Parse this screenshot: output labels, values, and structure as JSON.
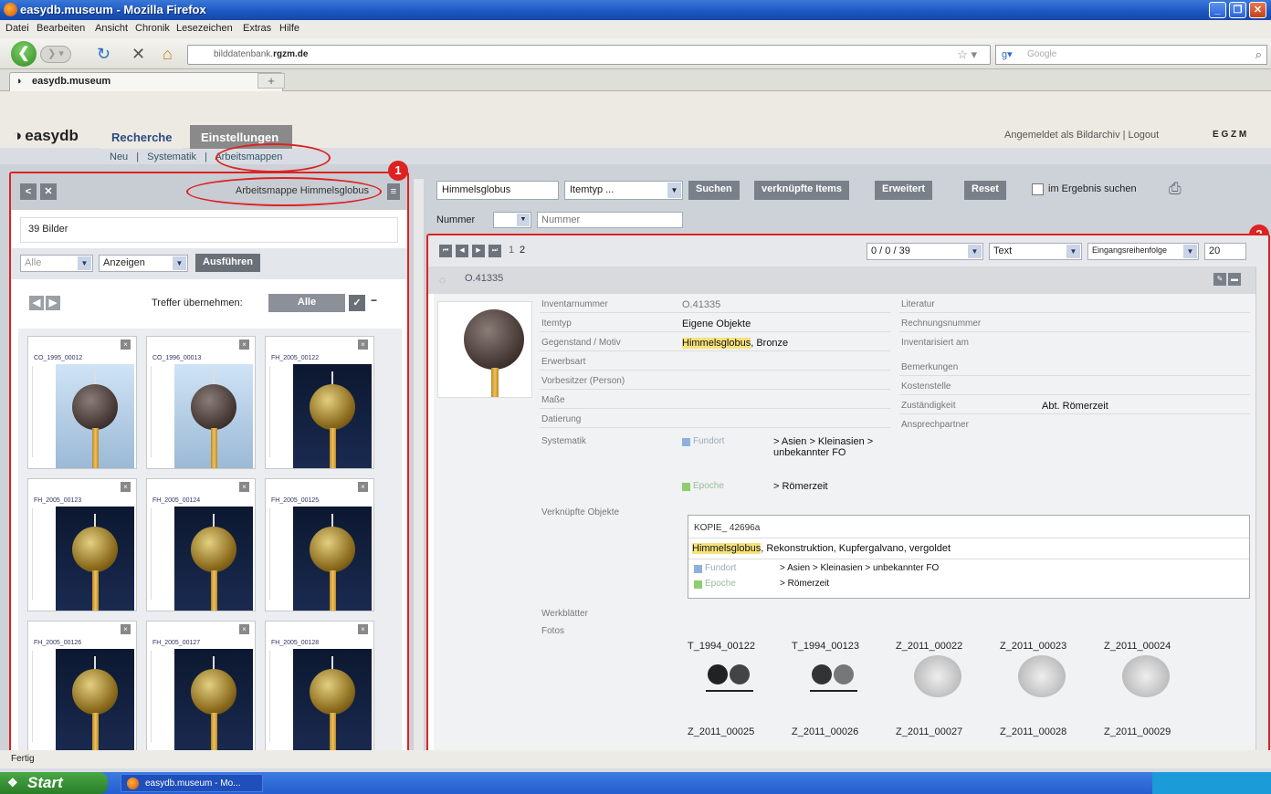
{
  "window": {
    "title": "easydb.museum - Mozilla Firefox"
  },
  "menu": [
    "Datei",
    "Bearbeiten",
    "Ansicht",
    "Chronik",
    "Lesezeichen",
    "Extras",
    "Hilfe"
  ],
  "browser": {
    "url_prefix": "bilddatenbank.",
    "url_domain": "rgzm.de",
    "search_placeholder": "Google",
    "tab_title": "easydb.museum",
    "new_tab": "+"
  },
  "app": {
    "logo": "easydb",
    "tabs": {
      "recherche": "Recherche",
      "einstellungen": "Einstellungen"
    },
    "subnav": {
      "neu": "Neu",
      "sep": "|",
      "systematik": "Systematik",
      "arbeitsmappen": "Arbeitsmappen"
    },
    "login_text": "Angemeldet als Bildarchiv | Logout",
    "langs": "E G Z M"
  },
  "left": {
    "folder_title": "Arbeitsmappe Himmelsglobus",
    "count": "39 Bilder",
    "select_all": "Alle",
    "action_select": "Anzeigen",
    "execute": "Ausführen",
    "take_over_label": "Treffer übernehmen:",
    "take_over_value": "Alle",
    "badge": "1",
    "cards": [
      {
        "id": "CO_1995_00012"
      },
      {
        "id": "CO_1996_00013"
      },
      {
        "id": "FH_2005_00122"
      },
      {
        "id": "FH_2005_00123"
      },
      {
        "id": "FH_2005_00124"
      },
      {
        "id": "FH_2005_00125"
      },
      {
        "id": "FH_2005_00126"
      },
      {
        "id": "FH_2005_00127"
      },
      {
        "id": "FH_2005_00128"
      }
    ]
  },
  "search": {
    "query": "Himmelsglobus",
    "itemtype": "Itemtyp ...",
    "btn_search": "Suchen",
    "btn_linked": "verknüpfte Items",
    "btn_extended": "Erweitert",
    "btn_reset": "Reset",
    "in_result": "im Ergebnis suchen",
    "field_label": "Nummer",
    "field_placeholder": "Nummer"
  },
  "result": {
    "badge": "2",
    "pages": [
      "1",
      "2"
    ],
    "range": "0 / 0 / 39",
    "view": "Text",
    "sort": "Eingangsreihenfolge",
    "per_page": "20",
    "record_id": "O.41335",
    "fields_left": [
      {
        "label": "Inventarnummer",
        "value": "O.41335"
      },
      {
        "label": "Itemtyp",
        "value": "Eigene Objekte"
      },
      {
        "label": "Gegenstand / Motiv",
        "value_hl": "Himmelsglobus",
        "value": ", Bronze"
      },
      {
        "label": "Erwerbsart",
        "value": ""
      },
      {
        "label": "Vorbesitzer (Person)",
        "value": ""
      },
      {
        "label": "Maße",
        "value": ""
      },
      {
        "label": "Datierung",
        "value": ""
      }
    ],
    "fields_right": [
      {
        "label": "Literatur",
        "value": ""
      },
      {
        "label": "Rechnungsnummer",
        "value": ""
      },
      {
        "label": "Inventarisiert am",
        "value": ""
      },
      {
        "label": "Bemerkungen",
        "value": ""
      },
      {
        "label": "Kostenstelle",
        "value": ""
      },
      {
        "label": "Zuständigkeit",
        "value": "Abt. Römerzeit"
      },
      {
        "label": "Ansprechpartner",
        "value": ""
      }
    ],
    "systematik_label": "Systematik",
    "fundort_label": "Fundort",
    "fundort_value": "> Asien > Kleinasien > unbekannter FO",
    "epoche_label": "Epoche",
    "epoche_value": "> Römerzeit",
    "linked_label": "Verknüpfte Objekte",
    "linked_id": "KOPIE_ 42696a",
    "linked_hl": "Himmelsglobus",
    "linked_desc": ", Rekonstruktion, Kupfergalvano, vergoldet",
    "linked_fundort": "> Asien > Kleinasien > unbekannter FO",
    "linked_epoche": "> Römerzeit",
    "werkblaetter_label": "Werkblätter",
    "fotos_label": "Fotos",
    "fotos_row1": [
      "T_1994_00122",
      "T_1994_00123",
      "Z_2011_00022",
      "Z_2011_00023",
      "Z_2011_00024"
    ],
    "fotos_row2": [
      "Z_2011_00025",
      "Z_2011_00026",
      "Z_2011_00027",
      "Z_2011_00028",
      "Z_2011_00029"
    ]
  },
  "status": "Fertig",
  "taskbar": {
    "start": "Start",
    "item": "easydb.museum - Mo..."
  },
  "colors": {
    "annotation": "#dd2222",
    "titlebar": "#1b55c0",
    "taskbar": "#245ed0"
  }
}
